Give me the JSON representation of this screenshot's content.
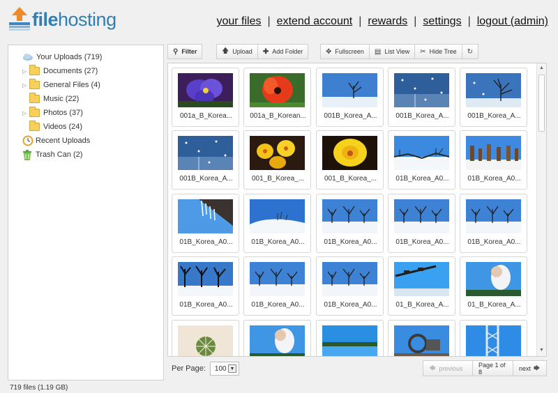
{
  "app": {
    "logo_text_bold": "file",
    "logo_text": "hosting"
  },
  "topnav": [
    {
      "label": "your files"
    },
    {
      "label": "extend account"
    },
    {
      "label": "rewards"
    },
    {
      "label": "settings"
    },
    {
      "label": "logout (admin)"
    }
  ],
  "tree": {
    "root": "Your Uploads (719)",
    "folders": [
      {
        "label": "Documents (27)",
        "expandable": true
      },
      {
        "label": "General Files (4)",
        "expandable": true
      },
      {
        "label": "Music (22)",
        "expandable": false
      },
      {
        "label": "Photos (37)",
        "expandable": true
      },
      {
        "label": "Videos (24)",
        "expandable": false
      }
    ],
    "recent": "Recent Uploads",
    "trash": "Trash Can (2)"
  },
  "status": {
    "files": "719 files (1.19 GB)"
  },
  "toolbar": {
    "filter": "Filter",
    "upload": "Upload",
    "add_folder": "Add Folder",
    "fullscreen": "Fullscreen",
    "list_view": "List View",
    "hide_tree": "Hide Tree"
  },
  "thumbnails": [
    {
      "caption": "001a_B_Korea...",
      "scene": "violet-flower"
    },
    {
      "caption": "001a_B_Korean...",
      "scene": "red-flower"
    },
    {
      "caption": "001B_Korea_A...",
      "scene": "winter-tree"
    },
    {
      "caption": "001B_Korea_A...",
      "scene": "snowy-blue"
    },
    {
      "caption": "001B_Korea_A...",
      "scene": "winter-tree-blue"
    },
    {
      "caption": "001B_Korea_A...",
      "scene": "snowy-blue"
    },
    {
      "caption": "001_B_Korea_...",
      "scene": "yellow-flowers"
    },
    {
      "caption": "001_B_Korea_...",
      "scene": "yellow-flower"
    },
    {
      "caption": "01B_Korea_A0...",
      "scene": "winter-field"
    },
    {
      "caption": "01B_Korea_A0...",
      "scene": "wood-posts"
    },
    {
      "caption": "01B_Korea_A0...",
      "scene": "icicles"
    },
    {
      "caption": "01B_Korea_A0...",
      "scene": "snow-hills"
    },
    {
      "caption": "01B_Korea_A0...",
      "scene": "snow-trees"
    },
    {
      "caption": "01B_Korea_A0...",
      "scene": "snow-trees"
    },
    {
      "caption": "01B_Korea_A0...",
      "scene": "snow-trees"
    },
    {
      "caption": "01B_Korea_A0...",
      "scene": "dark-trees"
    },
    {
      "caption": "01B_Korea_A0...",
      "scene": "snow-trees"
    },
    {
      "caption": "01B_Korea_A0...",
      "scene": "snow-trees"
    },
    {
      "caption": "01_B_Korea_A...",
      "scene": "sky-branch"
    },
    {
      "caption": "01_B_Korea_A...",
      "scene": "sky-cloud"
    },
    {
      "caption": "",
      "scene": "cactus"
    },
    {
      "caption": "",
      "scene": "sky-cloud"
    },
    {
      "caption": "",
      "scene": "lake"
    },
    {
      "caption": "",
      "scene": "machine"
    },
    {
      "caption": "",
      "scene": "sky-structure"
    }
  ],
  "footer": {
    "per_page_label": "Per Page:",
    "per_page_value": "100",
    "previous": "previous",
    "page": "Page 1 of 8",
    "next": "next"
  }
}
